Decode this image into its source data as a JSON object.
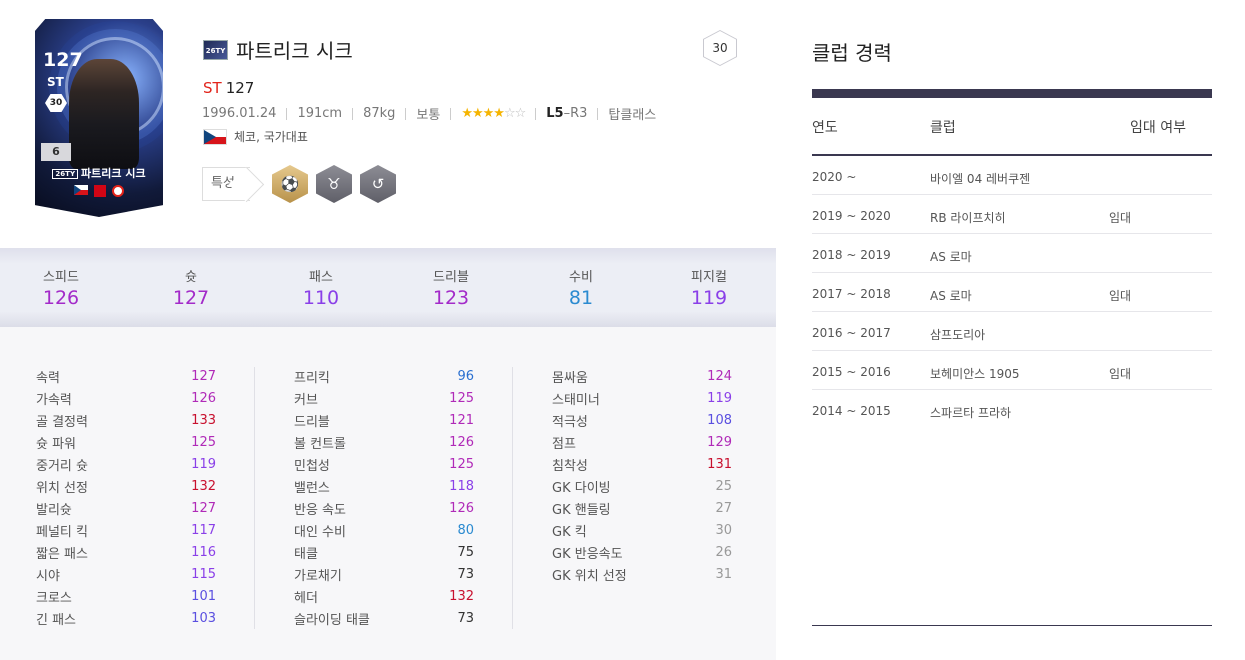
{
  "player": {
    "card_ovr": "127",
    "card_pos": "ST",
    "card_season_level": "30",
    "card_enhance": "6",
    "card_name": "파트리크 시크",
    "season_badge": "26TY",
    "name": "파트리크 시크",
    "position": "ST",
    "ovr": "127",
    "birth": "1996.01.24",
    "height": "191cm",
    "weight": "87kg",
    "body_type": "보통",
    "skill_stars": 4,
    "skill_stars_max": 6,
    "foot_left": "L5",
    "foot_dash": "–",
    "foot_right": "R3",
    "class": "탑클래스",
    "nation": "체코, 국가대표",
    "traits_label": "특성",
    "upgrade_level": "30"
  },
  "summary": [
    {
      "label": "스피드",
      "value": "126",
      "color": "#a32ac9"
    },
    {
      "label": "슛",
      "value": "127",
      "color": "#a32ac9"
    },
    {
      "label": "패스",
      "value": "110",
      "color": "#8a3fe8"
    },
    {
      "label": "드리블",
      "value": "123",
      "color": "#a32ac9"
    },
    {
      "label": "수비",
      "value": "81",
      "color": "#2a8ad0"
    },
    {
      "label": "피지컬",
      "value": "119",
      "color": "#8a3fe8"
    }
  ],
  "stats_col1": [
    {
      "label": "속력",
      "value": "127",
      "color": "#b02ab8"
    },
    {
      "label": "가속력",
      "value": "126",
      "color": "#b02ab8"
    },
    {
      "label": "골 결정력",
      "value": "133",
      "color": "#c8102e"
    },
    {
      "label": "슛 파워",
      "value": "125",
      "color": "#b02ab8"
    },
    {
      "label": "중거리 슛",
      "value": "119",
      "color": "#8a3fe8"
    },
    {
      "label": "위치 선정",
      "value": "132",
      "color": "#c8102e"
    },
    {
      "label": "발리슛",
      "value": "127",
      "color": "#b02ab8"
    },
    {
      "label": "페널티 킥",
      "value": "117",
      "color": "#8a3fe8"
    },
    {
      "label": "짧은 패스",
      "value": "116",
      "color": "#8a3fe8"
    },
    {
      "label": "시야",
      "value": "115",
      "color": "#8a3fe8"
    },
    {
      "label": "크로스",
      "value": "101",
      "color": "#5a4fe0"
    },
    {
      "label": "긴 패스",
      "value": "103",
      "color": "#5a4fe0"
    }
  ],
  "stats_col2": [
    {
      "label": "프리킥",
      "value": "96",
      "color": "#2a6fd0"
    },
    {
      "label": "커브",
      "value": "125",
      "color": "#b02ab8"
    },
    {
      "label": "드리블",
      "value": "121",
      "color": "#b02ab8"
    },
    {
      "label": "볼 컨트롤",
      "value": "126",
      "color": "#b02ab8"
    },
    {
      "label": "민첩성",
      "value": "125",
      "color": "#b02ab8"
    },
    {
      "label": "밸런스",
      "value": "118",
      "color": "#8a3fe8"
    },
    {
      "label": "반응 속도",
      "value": "126",
      "color": "#b02ab8"
    },
    {
      "label": "대인 수비",
      "value": "80",
      "color": "#2a8ad0"
    },
    {
      "label": "태클",
      "value": "75",
      "color": "#333333"
    },
    {
      "label": "가로채기",
      "value": "73",
      "color": "#333333"
    },
    {
      "label": "헤더",
      "value": "132",
      "color": "#c8102e"
    },
    {
      "label": "슬라이딩 태클",
      "value": "73",
      "color": "#333333"
    }
  ],
  "stats_col3": [
    {
      "label": "몸싸움",
      "value": "124",
      "color": "#b02ab8"
    },
    {
      "label": "스태미너",
      "value": "119",
      "color": "#8a3fe8"
    },
    {
      "label": "적극성",
      "value": "108",
      "color": "#5a4fe0"
    },
    {
      "label": "점프",
      "value": "129",
      "color": "#b02ab8"
    },
    {
      "label": "침착성",
      "value": "131",
      "color": "#c8102e"
    },
    {
      "label": "GK 다이빙",
      "value": "25",
      "color": "#999999"
    },
    {
      "label": "GK 핸들링",
      "value": "27",
      "color": "#999999"
    },
    {
      "label": "GK 킥",
      "value": "30",
      "color": "#999999"
    },
    {
      "label": "GK 반응속도",
      "value": "26",
      "color": "#999999"
    },
    {
      "label": "GK 위치 선정",
      "value": "31",
      "color": "#999999"
    }
  ],
  "career": {
    "title": "클럽 경력",
    "headers": {
      "year": "연도",
      "club": "클럽",
      "loan": "임대 여부"
    },
    "rows": [
      {
        "year": "2020 ~",
        "club": "바이엘 04 레버쿠젠",
        "loan": ""
      },
      {
        "year": "2019 ~ 2020",
        "club": "RB 라이프치히",
        "loan": "임대"
      },
      {
        "year": "2018 ~ 2019",
        "club": "AS 로마",
        "loan": ""
      },
      {
        "year": "2017 ~ 2018",
        "club": "AS 로마",
        "loan": "임대"
      },
      {
        "year": "2016 ~ 2017",
        "club": "삼프도리아",
        "loan": ""
      },
      {
        "year": "2015 ~ 2016",
        "club": "보헤미안스 1905",
        "loan": "임대"
      },
      {
        "year": "2014 ~ 2015",
        "club": "스파르타 프라하",
        "loan": ""
      }
    ]
  },
  "icons": {
    "traits": [
      "finesse-shot-trait-icon",
      "power-header-trait-icon",
      "flair-trait-icon"
    ]
  }
}
